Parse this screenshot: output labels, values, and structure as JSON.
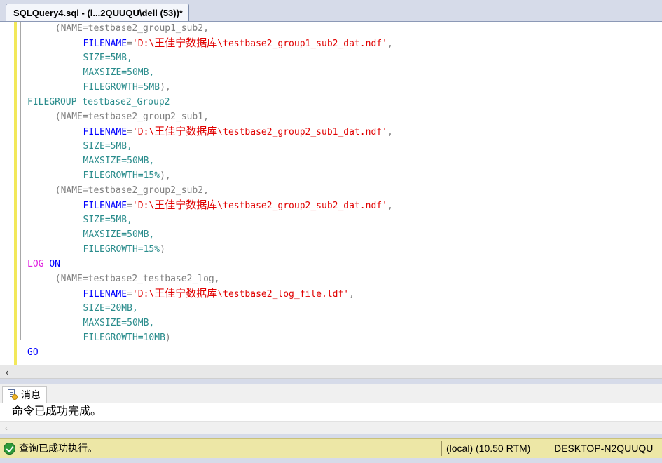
{
  "tab": {
    "title": "SQLQuery4.sql - (l...2QUUQU\\dell (53))*"
  },
  "code_lines": [
    {
      "indent": "    ",
      "parts": [
        {
          "t": "(NAME=testbase2_group1_sub2,",
          "c": "gy"
        }
      ]
    },
    {
      "indent": "        ",
      "parts": [
        {
          "t": "FILENAME",
          "c": "bl"
        },
        {
          "t": "=",
          "c": "gy"
        },
        {
          "t": "'D:\\",
          "c": "str"
        },
        {
          "t": "王佳宁数据库",
          "c": "str cn"
        },
        {
          "t": "\\testbase2_group1_sub2_dat.ndf'",
          "c": "str"
        },
        {
          "t": ",",
          "c": "gy"
        }
      ]
    },
    {
      "indent": "        ",
      "parts": [
        {
          "t": "SIZE=5MB,",
          "c": "kw"
        }
      ]
    },
    {
      "indent": "        ",
      "parts": [
        {
          "t": "MAXSIZE=50MB,",
          "c": "kw"
        }
      ]
    },
    {
      "indent": "        ",
      "parts": [
        {
          "t": "FILEGROWTH=5MB",
          "c": "kw"
        },
        {
          "t": "),",
          "c": "gy"
        }
      ]
    },
    {
      "indent": "",
      "parts": [
        {
          "t": "FILEGROUP testbase2_Group2",
          "c": "kw"
        }
      ]
    },
    {
      "indent": "    ",
      "parts": [
        {
          "t": "(NAME=testbase2_group2_sub1,",
          "c": "gy"
        }
      ]
    },
    {
      "indent": "        ",
      "parts": [
        {
          "t": "FILENAME",
          "c": "bl"
        },
        {
          "t": "=",
          "c": "gy"
        },
        {
          "t": "'D:\\",
          "c": "str"
        },
        {
          "t": "王佳宁数据库",
          "c": "str cn"
        },
        {
          "t": "\\testbase2_group2_sub1_dat.ndf'",
          "c": "str"
        },
        {
          "t": ",",
          "c": "gy"
        }
      ]
    },
    {
      "indent": "        ",
      "parts": [
        {
          "t": "SIZE=5MB,",
          "c": "kw"
        }
      ]
    },
    {
      "indent": "        ",
      "parts": [
        {
          "t": "MAXSIZE=50MB,",
          "c": "kw"
        }
      ]
    },
    {
      "indent": "        ",
      "parts": [
        {
          "t": "FILEGROWTH=15%",
          "c": "kw"
        },
        {
          "t": "),",
          "c": "gy"
        }
      ]
    },
    {
      "indent": "    ",
      "parts": [
        {
          "t": "(NAME=testbase2_group2_sub2,",
          "c": "gy"
        }
      ]
    },
    {
      "indent": "        ",
      "parts": [
        {
          "t": "FILENAME",
          "c": "bl"
        },
        {
          "t": "=",
          "c": "gy"
        },
        {
          "t": "'D:\\",
          "c": "str"
        },
        {
          "t": "王佳宁数据库",
          "c": "str cn"
        },
        {
          "t": "\\testbase2_group2_sub2_dat.ndf'",
          "c": "str"
        },
        {
          "t": ",",
          "c": "gy"
        }
      ]
    },
    {
      "indent": "        ",
      "parts": [
        {
          "t": "SIZE=5MB,",
          "c": "kw"
        }
      ]
    },
    {
      "indent": "        ",
      "parts": [
        {
          "t": "MAXSIZE=50MB,",
          "c": "kw"
        }
      ]
    },
    {
      "indent": "        ",
      "parts": [
        {
          "t": "FILEGROWTH=15%",
          "c": "kw"
        },
        {
          "t": ")",
          "c": "gy"
        }
      ]
    },
    {
      "indent": "",
      "parts": [
        {
          "t": "LOG ",
          "c": "pk"
        },
        {
          "t": "ON",
          "c": "bl"
        }
      ]
    },
    {
      "indent": "    ",
      "parts": [
        {
          "t": "(NAME=testbase2_testbase2_log,",
          "c": "gy"
        }
      ]
    },
    {
      "indent": "        ",
      "parts": [
        {
          "t": "FILENAME",
          "c": "bl"
        },
        {
          "t": "=",
          "c": "gy"
        },
        {
          "t": "'D:\\",
          "c": "str"
        },
        {
          "t": "王佳宁数据库",
          "c": "str cn"
        },
        {
          "t": "\\testbase2_log_file.ldf'",
          "c": "str"
        },
        {
          "t": ",",
          "c": "gy"
        }
      ]
    },
    {
      "indent": "        ",
      "parts": [
        {
          "t": "SIZE=20MB,",
          "c": "kw"
        }
      ]
    },
    {
      "indent": "        ",
      "parts": [
        {
          "t": "MAXSIZE=50MB,",
          "c": "kw"
        }
      ]
    },
    {
      "indent": "        ",
      "parts": [
        {
          "t": "FILEGROWTH=10MB",
          "c": "kw"
        },
        {
          "t": ")",
          "c": "gy"
        }
      ]
    },
    {
      "indent": "",
      "parts": [
        {
          "t": "GO",
          "c": "bl"
        }
      ]
    }
  ],
  "results": {
    "tab_label": "消息",
    "message": "命令已成功完成。"
  },
  "status": {
    "message": "查询已成功执行。",
    "server": "(local) (10.50 RTM)",
    "host": "DESKTOP-N2QUUQU"
  },
  "colors": {
    "keyword": "#2a8c8c",
    "string": "#e00000",
    "operator": "#808080",
    "blue_keyword": "#0000ff",
    "pink_keyword": "#e020e0",
    "status_bar": "#ede7a6",
    "change_bar": "#f2e85a"
  },
  "icons": {
    "results_tab": "message-icon",
    "status": "success-check-icon",
    "scroll_left": "scroll-left-arrow-icon"
  }
}
